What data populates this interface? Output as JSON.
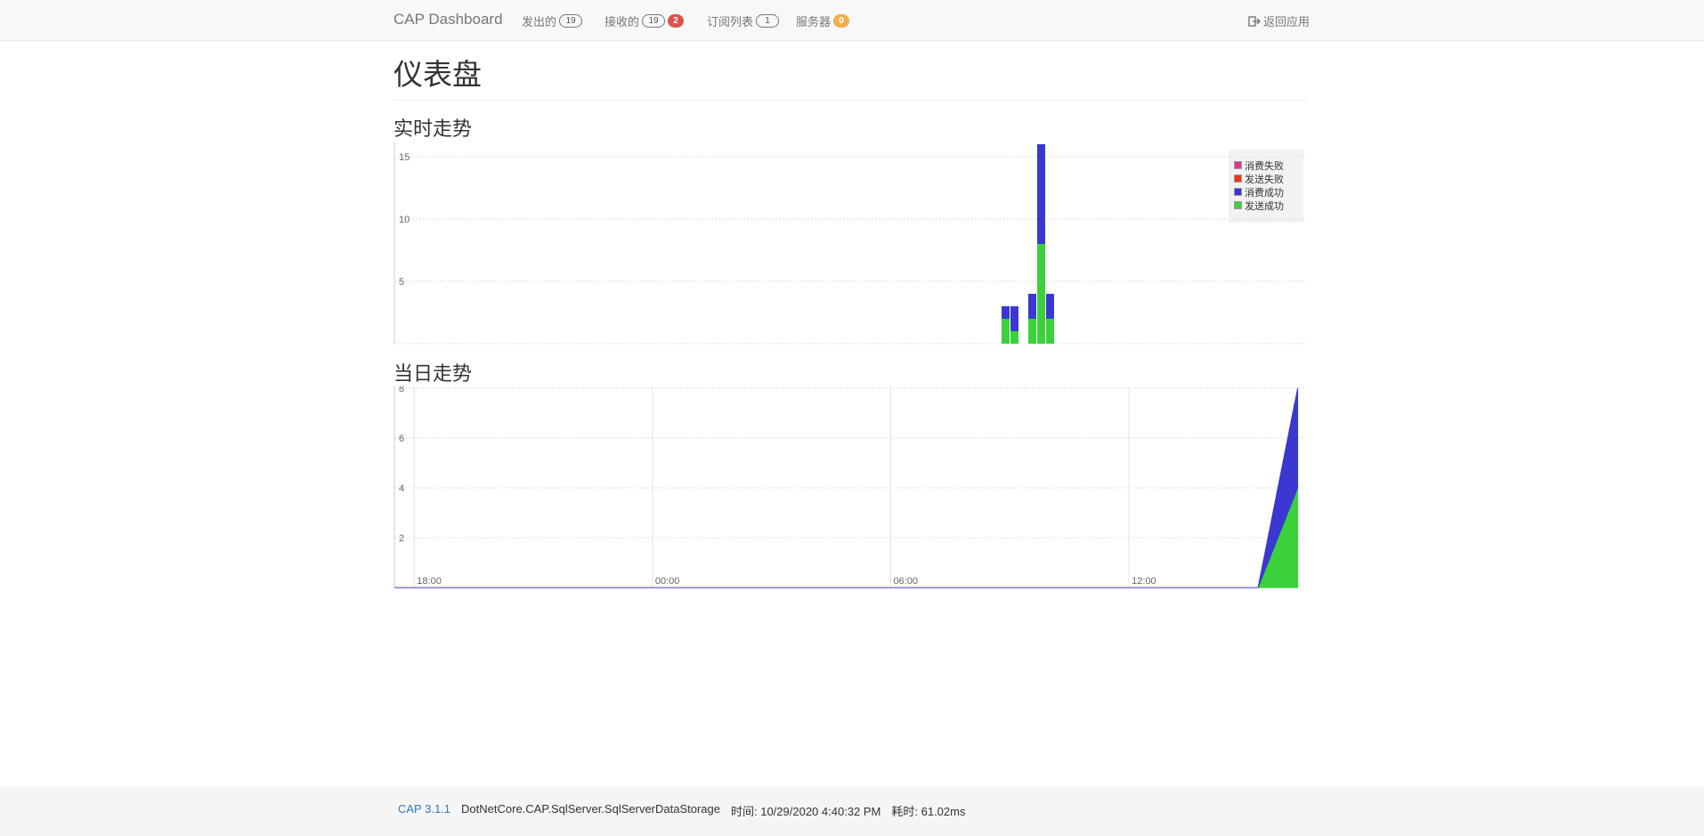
{
  "nav": {
    "brand": "CAP Dashboard",
    "items": [
      {
        "label": "发出的",
        "badge": "19",
        "badge_style": "outline"
      },
      {
        "label": "接收的",
        "badge": "19",
        "badge_style": "outline",
        "badge2": "2",
        "badge2_color": "#d9534f"
      },
      {
        "label": "订阅列表",
        "badge": "1",
        "badge_style": "outline"
      },
      {
        "label": "服务器",
        "badge": "0",
        "badge_style": "filled",
        "badge_color": "#f0ad4e"
      }
    ],
    "back": "返回应用"
  },
  "page": {
    "title": "仪表盘",
    "realtime_title": "实时走势",
    "daily_title": "当日走势"
  },
  "legend": [
    {
      "name": "消费失败",
      "color": "#e0338c"
    },
    {
      "name": "发送失败",
      "color": "#e63a17"
    },
    {
      "name": "消费成功",
      "color": "#3a38d1"
    },
    {
      "name": "发送成功",
      "color": "#3bd13b"
    }
  ],
  "chart_data": [
    {
      "type": "bar",
      "stacked": true,
      "ylim": [
        0,
        16
      ],
      "yticks": [
        5,
        10,
        15
      ],
      "grid": true,
      "legend_position": "top-right",
      "x": [
        0,
        1,
        2,
        3,
        4,
        5,
        6,
        7,
        8,
        9,
        10,
        11,
        12,
        13,
        14,
        15,
        16,
        17,
        18,
        19,
        20,
        21,
        22,
        23,
        24,
        25,
        26,
        27,
        28,
        29,
        30,
        31,
        32,
        33,
        34,
        35,
        36,
        37,
        38,
        39,
        40,
        41,
        42,
        43,
        44,
        45,
        46,
        47,
        48,
        49,
        50,
        51,
        52,
        53,
        54,
        55,
        56,
        57,
        58,
        59,
        60,
        61,
        62,
        63,
        64,
        65,
        66,
        67,
        68,
        69,
        70,
        71,
        72,
        73,
        74,
        75,
        76,
        77,
        78,
        79,
        80,
        81,
        82,
        83,
        84,
        85,
        86,
        87,
        88,
        89,
        90,
        91,
        92,
        93,
        94,
        95,
        96,
        97,
        98,
        99
      ],
      "series": [
        {
          "name": "发送成功",
          "color": "#3bd13b",
          "points": [
            [
              68,
              2
            ],
            [
              69,
              1
            ],
            [
              71,
              2
            ],
            [
              72,
              8
            ],
            [
              73,
              2
            ]
          ]
        },
        {
          "name": "消费成功",
          "color": "#3a38d1",
          "points": [
            [
              68,
              1
            ],
            [
              69,
              2
            ],
            [
              71,
              2
            ],
            [
              72,
              8
            ],
            [
              73,
              2
            ]
          ]
        },
        {
          "name": "发送失败",
          "color": "#e63a17",
          "points": []
        },
        {
          "name": "消费失败",
          "color": "#e0338c",
          "points": []
        }
      ]
    },
    {
      "type": "area",
      "stacked": true,
      "ylim": [
        0,
        8
      ],
      "yticks": [
        2,
        4,
        6,
        8
      ],
      "xlim": [
        17.5,
        18.5
      ],
      "xticks": [
        {
          "value": 18,
          "label": "18:00"
        },
        {
          "value": 24,
          "label": "00:00"
        },
        {
          "value": 30,
          "label": "06:00"
        },
        {
          "value": 36,
          "label": "12:00"
        }
      ],
      "grid": true,
      "series": [
        {
          "name": "发送成功",
          "color": "#3bd13b",
          "points": [
            [
              17.5,
              0
            ],
            [
              39.25,
              0
            ],
            [
              40.25,
              4
            ]
          ]
        },
        {
          "name": "消费成功",
          "color": "#3a38d1",
          "points": [
            [
              17.5,
              0
            ],
            [
              39.25,
              0
            ],
            [
              40.25,
              4
            ]
          ]
        }
      ]
    }
  ],
  "footer": {
    "version": "CAP 3.1.1",
    "storage": "DotNetCore.CAP.SqlServer.SqlServerDataStorage",
    "time": "时间: 10/29/2020 4:40:32 PM",
    "elapsed": "耗时: 61.02ms"
  }
}
